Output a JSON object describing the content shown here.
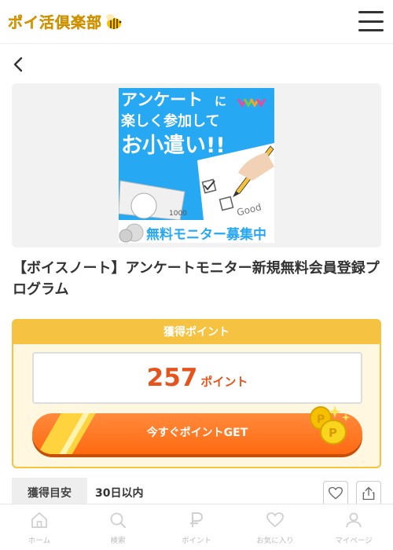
{
  "header": {
    "logo_text": "ポイ活倶楽部"
  },
  "banner": {
    "line1": "アンケート",
    "line1_suffix": "に",
    "line2": "楽しく参加して",
    "line3": "お小遣い!!",
    "bill": "1000",
    "paper_text": "Good",
    "bottom": "無料モニター募集中"
  },
  "offer": {
    "title": "【ボイスノート】アンケートモニター新規無料会員登録プログラム"
  },
  "points": {
    "header": "獲得ポイント",
    "value": "257",
    "unit": "ポイント",
    "button": "今すぐポイントGET"
  },
  "estimate": {
    "label": "獲得目安",
    "value": "30日以内"
  },
  "nav": [
    {
      "label": "ホーム",
      "icon": "home-icon"
    },
    {
      "label": "検索",
      "icon": "search-icon"
    },
    {
      "label": "ポイント",
      "icon": "point-icon"
    },
    {
      "label": "お気に入り",
      "icon": "heart-icon"
    },
    {
      "label": "マイページ",
      "icon": "user-icon"
    }
  ],
  "colors": {
    "brand_yellow": "#f5c242",
    "accent_orange": "#e5541c",
    "button_orange": "#ff6a10",
    "banner_blue": "#27a8f2"
  }
}
